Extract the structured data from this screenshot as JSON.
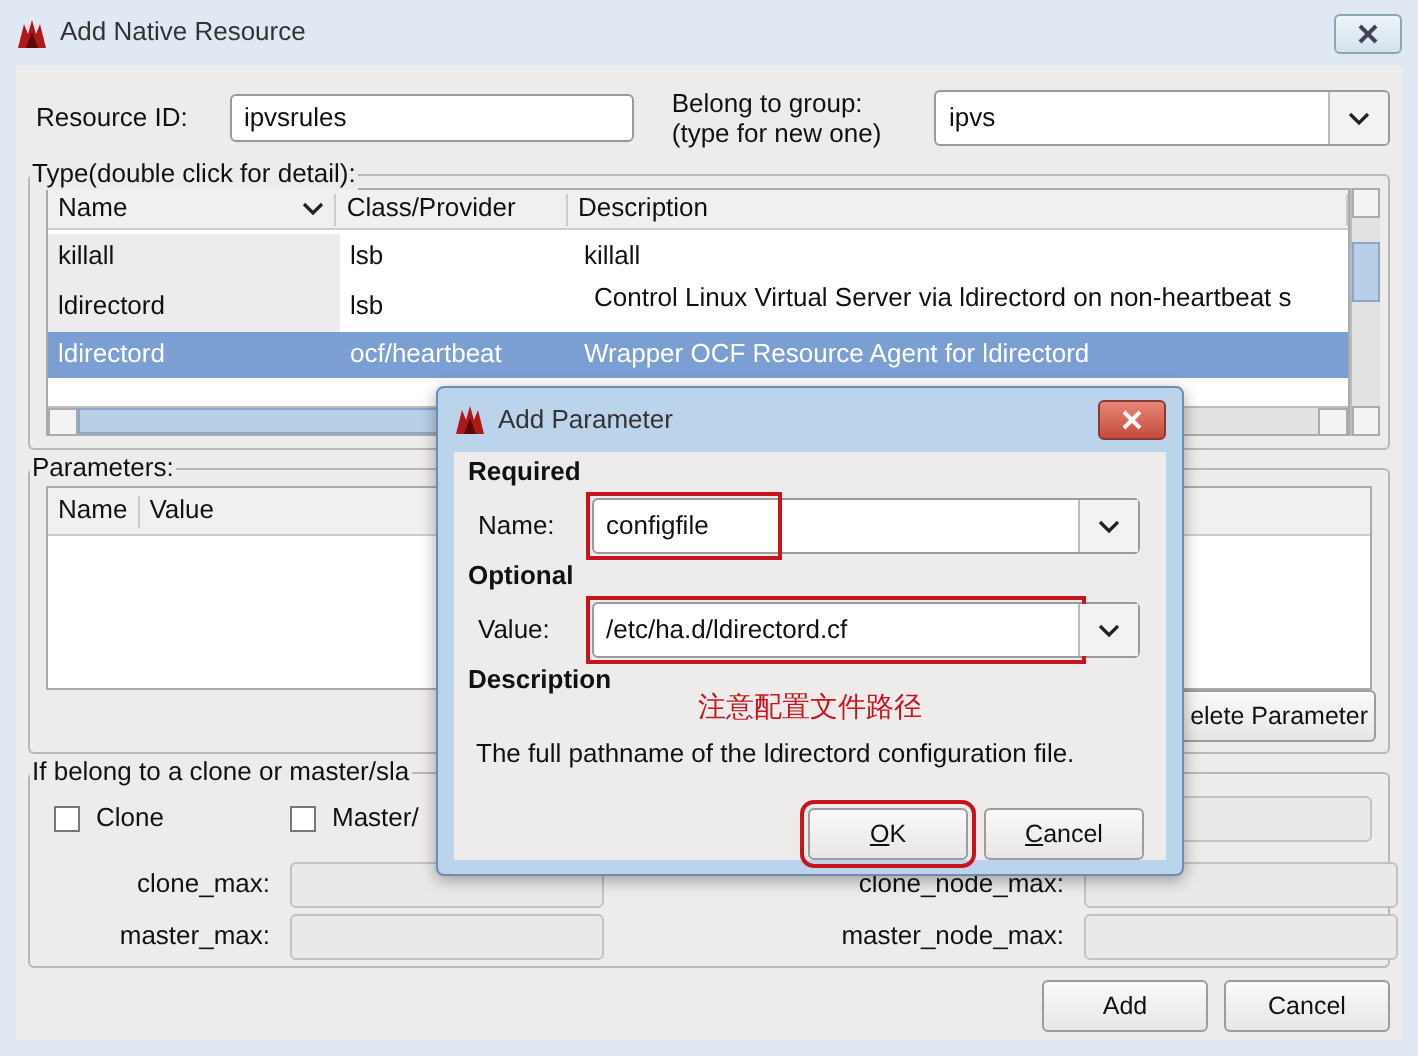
{
  "window": {
    "title": "Add Native Resource"
  },
  "resource_id": {
    "label": "Resource ID:",
    "value": "ipvsrules"
  },
  "group": {
    "label_lines": [
      "Belong to group:",
      "(type for new one)"
    ],
    "value": "ipvs"
  },
  "type_section": {
    "title": "Type(double click for detail):",
    "columns": [
      "Name",
      "Class/Provider",
      "Description"
    ],
    "rows": [
      {
        "cells": [
          "killall",
          "lsb",
          "killall"
        ],
        "selected": false
      },
      {
        "cells": [
          "ldirectord",
          "lsb",
          "Control Linux Virtual Server via ldirectord on non-heartbeat s"
        ],
        "selected": false
      },
      {
        "cells": [
          "ldirectord",
          "ocf/heartbeat",
          "Wrapper OCF Resource Agent for ldirectord"
        ],
        "selected": true
      }
    ]
  },
  "parameters": {
    "title": "Parameters:",
    "columns": [
      "Name",
      "Value"
    ],
    "button": "elete Parameter"
  },
  "clone_section": {
    "title": "If belong to a clone or master/sla",
    "checkboxes": [
      {
        "label": "Clone",
        "checked": false
      },
      {
        "label": "Master/",
        "checked": false
      }
    ],
    "fields": [
      {
        "label": "clone_max:"
      },
      {
        "label": "clone_node_max:"
      },
      {
        "label": "master_max:"
      },
      {
        "label": "master_node_max:"
      }
    ]
  },
  "buttons": [
    "Add",
    "Cancel"
  ],
  "dialog": {
    "title": "Add Parameter",
    "required": "Required",
    "name_label": "Name:",
    "name_value": "configfile",
    "name_highlighted": true,
    "optional": "Optional",
    "value_label": "Value:",
    "value": "/etc/ha.d/ldirectord.cf",
    "value_highlighted": true,
    "description_heading": "Description",
    "annotation": "注意配置文件路径",
    "description": "The full pathname of the ldirectord configuration file.",
    "buttons": [
      {
        "label": "OK",
        "highlighted": true
      },
      {
        "label": "Cancel",
        "highlighted": false
      }
    ]
  }
}
